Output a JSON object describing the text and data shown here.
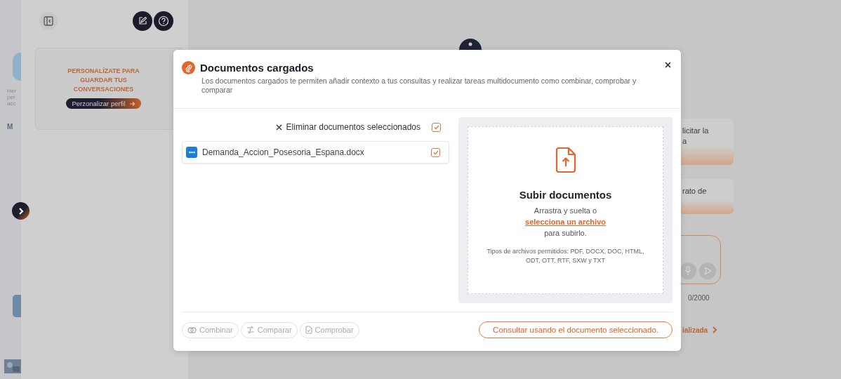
{
  "left_strip": {
    "texts": [
      "Her",
      "per",
      "acc",
      "M"
    ]
  },
  "sidebar": {
    "banner": {
      "title": "PERSONALÍZATE PARA GUARDAR TUS CONVERSACIONES",
      "button": "Perzonalizar perfil"
    }
  },
  "main": {
    "cards": [
      {
        "lines": [
          "licitar la",
          "a"
        ]
      },
      {
        "lines": [
          "rato de"
        ]
      }
    ],
    "counter": "0/2000",
    "link": "ializada"
  },
  "modal": {
    "title": "Documentos cargados",
    "subtitle": "Los documentos cargados te permiten añadir contexto a tus consultas y realizar tareas multidocumento como combinar, comprobar y comparar",
    "remove_selected": {
      "label": "Eliminar documentos seleccionados",
      "checked": true
    },
    "documents": [
      {
        "name": "Demanda_Accion_Posesoria_Espana.docx",
        "checked": true
      }
    ],
    "upload": {
      "title": "Subir documentos",
      "text_before": "Arrastra y suelta o",
      "link": "selecciona un archivo",
      "text_after": "para subirlo.",
      "allowed": "Tipos de archivos permitidos: PDF, DOCX, DOC, HTML, ODT, OTT, RTF, SXW y TXT"
    },
    "actions": [
      {
        "kind": "combine",
        "label": "Combinar",
        "disabled": true
      },
      {
        "kind": "compare",
        "label": "Comparar",
        "disabled": true
      },
      {
        "kind": "check",
        "label": "Comprobar",
        "disabled": true
      }
    ],
    "primary": "Consultar usando el documento seleccionado."
  }
}
